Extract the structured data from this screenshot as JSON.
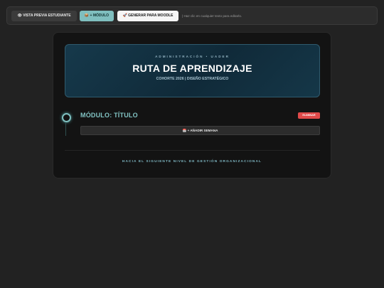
{
  "toolbar": {
    "preview_icon": "eye-icon",
    "preview_label": "👁 VISTA PREVIA ESTUDIANTE",
    "add_module_label": "📦 + MÓDULO",
    "moodle_label": "🚀 GENERAR PARA MOODLE",
    "hint": "| Haz clic en cualquier texto para editarlo."
  },
  "hero": {
    "kicker": "ADMINISTRACIÓN • UADER",
    "title": "RUTA DE APRENDIZAJE",
    "subtitle": "COHORTE 2026 | DISEÑO ESTRATÉGICO"
  },
  "module": {
    "title": "MÓDULO: TÍTULO",
    "delete_label": "ELIMINAR",
    "add_week_label": "📅 + AÑADIR SEMANA"
  },
  "footer": {
    "text": "HACIA EL SIGUIENTE NIVEL DE GESTIÓN ORGANIZACIONAL"
  },
  "colors": {
    "accent": "#7fbfbf",
    "danger": "#e04a4a",
    "background": "#222222",
    "card": "#131313"
  }
}
